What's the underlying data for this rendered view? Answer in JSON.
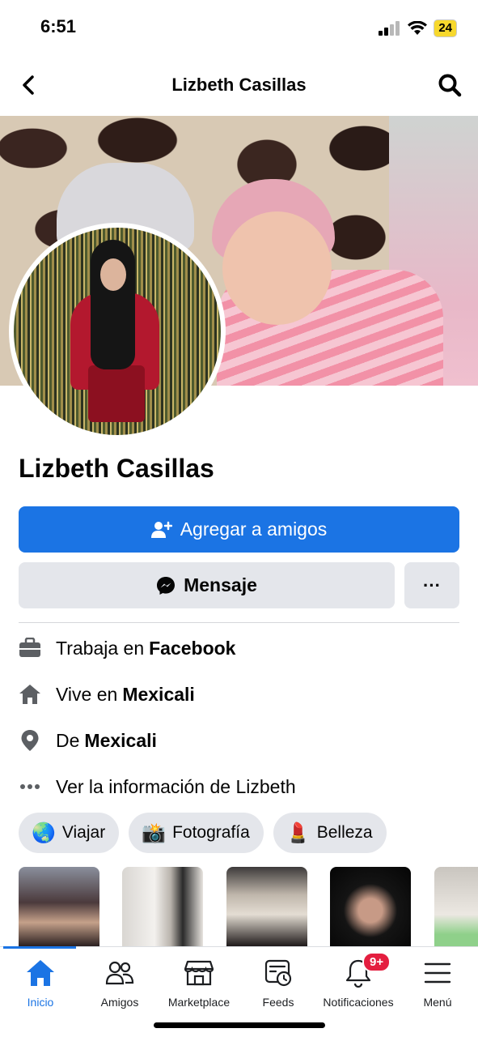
{
  "status_bar": {
    "time": "6:51",
    "battery": "24"
  },
  "header": {
    "title": "Lizbeth Casillas"
  },
  "profile": {
    "name": "Lizbeth Casillas",
    "add_friend_label": "Agregar a amigos",
    "message_label": "Mensaje",
    "more_label": "···"
  },
  "info": {
    "work_prefix": "Trabaja en",
    "work_value": "Facebook",
    "lives_prefix": "Vive en",
    "lives_value": "Mexicali",
    "from_prefix": "De",
    "from_value": "Mexicali",
    "see_info": "Ver la información de Lizbeth"
  },
  "hobbies": [
    {
      "emoji": "🌏",
      "label": "Viajar"
    },
    {
      "emoji": "📸",
      "label": "Fotografía"
    },
    {
      "emoji": "💄",
      "label": "Belleza"
    }
  ],
  "tabs": [
    {
      "label": "Inicio",
      "icon": "home-icon"
    },
    {
      "label": "Amigos",
      "icon": "friends-icon"
    },
    {
      "label": "Marketplace",
      "icon": "marketplace-icon"
    },
    {
      "label": "Feeds",
      "icon": "feeds-icon"
    },
    {
      "label": "Notificaciones",
      "icon": "bell-icon",
      "badge": "9+"
    },
    {
      "label": "Menú",
      "icon": "menu-icon"
    }
  ],
  "colors": {
    "accent": "#1b74e4",
    "badge": "#e41e3f",
    "button_gray": "#e4e6eb"
  }
}
